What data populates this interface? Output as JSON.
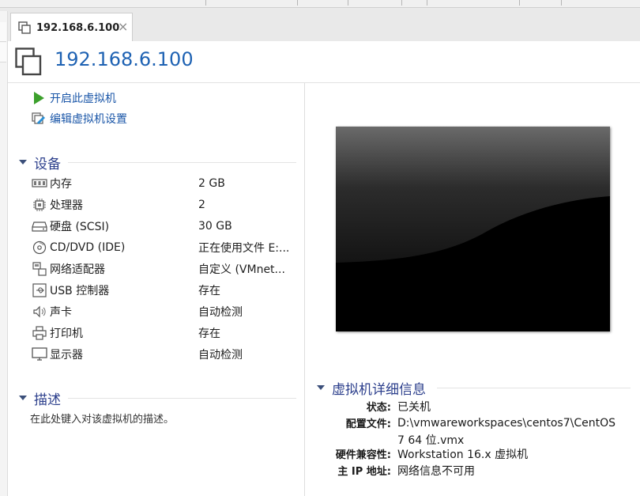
{
  "tab": {
    "title": "192.168.6.100",
    "close_glyph": "×",
    "icon": "vm-icon"
  },
  "header": {
    "title": "192.168.6.100",
    "icon": "vm-large-icon"
  },
  "actions": [
    {
      "label": "开启此虚拟机",
      "icon": "play-icon"
    },
    {
      "label": "编辑虚拟机设置",
      "icon": "edit-settings-icon"
    }
  ],
  "devices": {
    "title": "设备",
    "items": [
      {
        "name": "内存",
        "value": "2 GB",
        "icon": "memory-icon"
      },
      {
        "name": "处理器",
        "value": "2",
        "icon": "processor-icon"
      },
      {
        "name": "硬盘 (SCSI)",
        "value": "30 GB",
        "icon": "harddisk-icon"
      },
      {
        "name": "CD/DVD (IDE)",
        "value": "正在使用文件 E:...",
        "icon": "cd-dvd-icon"
      },
      {
        "name": "网络适配器",
        "value": "自定义 (VMnet...",
        "icon": "network-adapter-icon"
      },
      {
        "name": "USB 控制器",
        "value": "存在",
        "icon": "usb-icon"
      },
      {
        "name": "声卡",
        "value": "自动检测",
        "icon": "sound-card-icon"
      },
      {
        "name": "打印机",
        "value": "存在",
        "icon": "printer-icon"
      },
      {
        "name": "显示器",
        "value": "自动检测",
        "icon": "display-icon"
      }
    ]
  },
  "description": {
    "title": "描述",
    "placeholder": "在此处键入对该虚拟机的描述。"
  },
  "details": {
    "title": "虚拟机详细信息",
    "status_label": "状态:",
    "status_value": "已关机",
    "config_label": "配置文件:",
    "config_value_line1": "D:\\vmwareworkspaces\\centos7\\CentOS",
    "config_value_line2": "7 64 位.vmx",
    "compat_label": "硬件兼容性:",
    "compat_value": "Workstation 16.x 虚拟机",
    "ip_label": "主 IP 地址:",
    "ip_value": "网络信息不可用"
  },
  "colors": {
    "link": "#1a56a8",
    "section": "#2c3f8c",
    "title": "#1e62b3",
    "play": "#3ca02c"
  }
}
